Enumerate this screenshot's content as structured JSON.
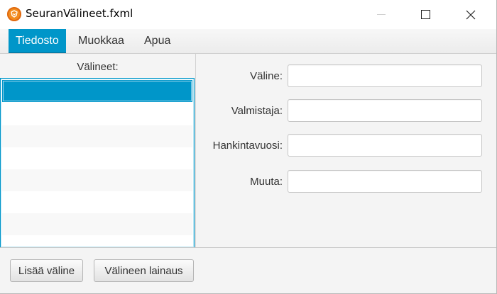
{
  "window": {
    "title": "SeuranVälineet.fxml",
    "icon": "app-logo-icon",
    "controls": [
      "minimize-icon",
      "maximize-icon",
      "close-icon"
    ]
  },
  "menubar": {
    "items": [
      {
        "label": "Tiedosto",
        "active": true
      },
      {
        "label": "Muokkaa",
        "active": false
      },
      {
        "label": "Apua",
        "active": false
      }
    ]
  },
  "left_panel": {
    "label": "Välineet:",
    "rows": 7,
    "selected_row": 0
  },
  "form": {
    "fields": [
      {
        "label": "Väline:",
        "value": ""
      },
      {
        "label": "Valmistaja:",
        "value": ""
      },
      {
        "label": "Hankintavuosi:",
        "value": ""
      },
      {
        "label": "Muuta:",
        "value": ""
      }
    ]
  },
  "buttons": {
    "add_label": "Lisää väline",
    "loan_label": "Välineen lainaus"
  },
  "colors": {
    "accent": "#0096c9",
    "background": "#f4f4f4"
  }
}
